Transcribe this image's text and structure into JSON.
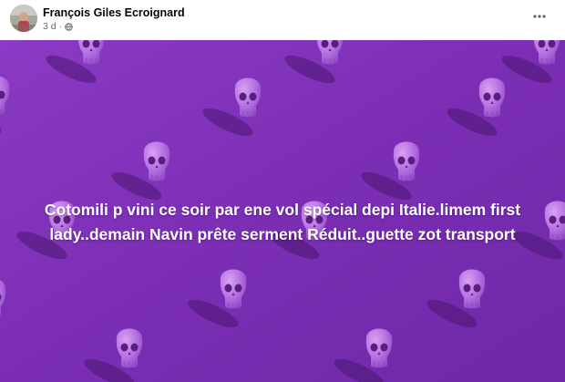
{
  "post": {
    "author": "François Giles Ecroignard",
    "time": "3 d",
    "separator": "·",
    "privacy_icon": "globe-icon",
    "menu_icon": "more-options-icon",
    "avatar_icon": "profile-avatar"
  },
  "banner": {
    "text": "Cotomili p vini ce soir par ene vol spécial depi Italie.limem first lady..demain Navin prête serment Réduit..guette zot transport",
    "background_color": "#7f2fb8",
    "pattern_icon": "skull-pattern"
  }
}
